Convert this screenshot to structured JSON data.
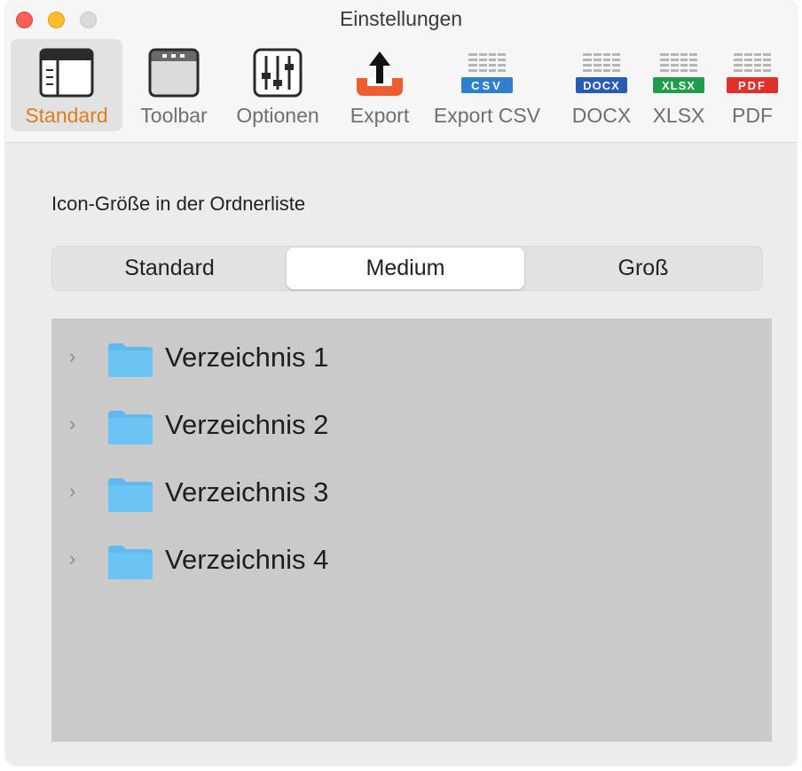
{
  "window": {
    "title": "Einstellungen"
  },
  "toolbar": {
    "items": [
      {
        "label": "Standard",
        "icon": "sidebar-layout-icon",
        "selected": true
      },
      {
        "label": "Toolbar",
        "icon": "window-toolbar-icon",
        "selected": false
      },
      {
        "label": "Optionen",
        "icon": "sliders-icon",
        "selected": false
      },
      {
        "label": "Export",
        "icon": "export-tray-icon",
        "selected": false
      },
      {
        "label": "Export CSV",
        "icon": "csv-file-icon",
        "badge": "CSV",
        "badge_color": "#2f7fd0",
        "selected": false
      },
      {
        "label": "DOCX",
        "icon": "docx-file-icon",
        "badge": "DOCX",
        "badge_color": "#2a5ab8",
        "selected": false
      },
      {
        "label": "XLSX",
        "icon": "xlsx-file-icon",
        "badge": "XLSX",
        "badge_color": "#1f9d4a",
        "selected": false
      },
      {
        "label": "PDF",
        "icon": "pdf-file-icon",
        "badge": "PDF",
        "badge_color": "#e0302a",
        "selected": false
      }
    ]
  },
  "settings": {
    "section_label": "Icon-Größe in der Ordnerliste",
    "size_options": [
      "Standard",
      "Medium",
      "Groß"
    ],
    "selected_size": "Medium"
  },
  "folder_list": {
    "items": [
      {
        "label": "Verzeichnis 1"
      },
      {
        "label": "Verzeichnis 2"
      },
      {
        "label": "Verzeichnis 3"
      },
      {
        "label": "Verzeichnis 4"
      }
    ]
  },
  "colors": {
    "accent": "#e47a1e",
    "folder": "#6cc4f5",
    "close": "#fe5f57",
    "minimize": "#febc2e"
  }
}
